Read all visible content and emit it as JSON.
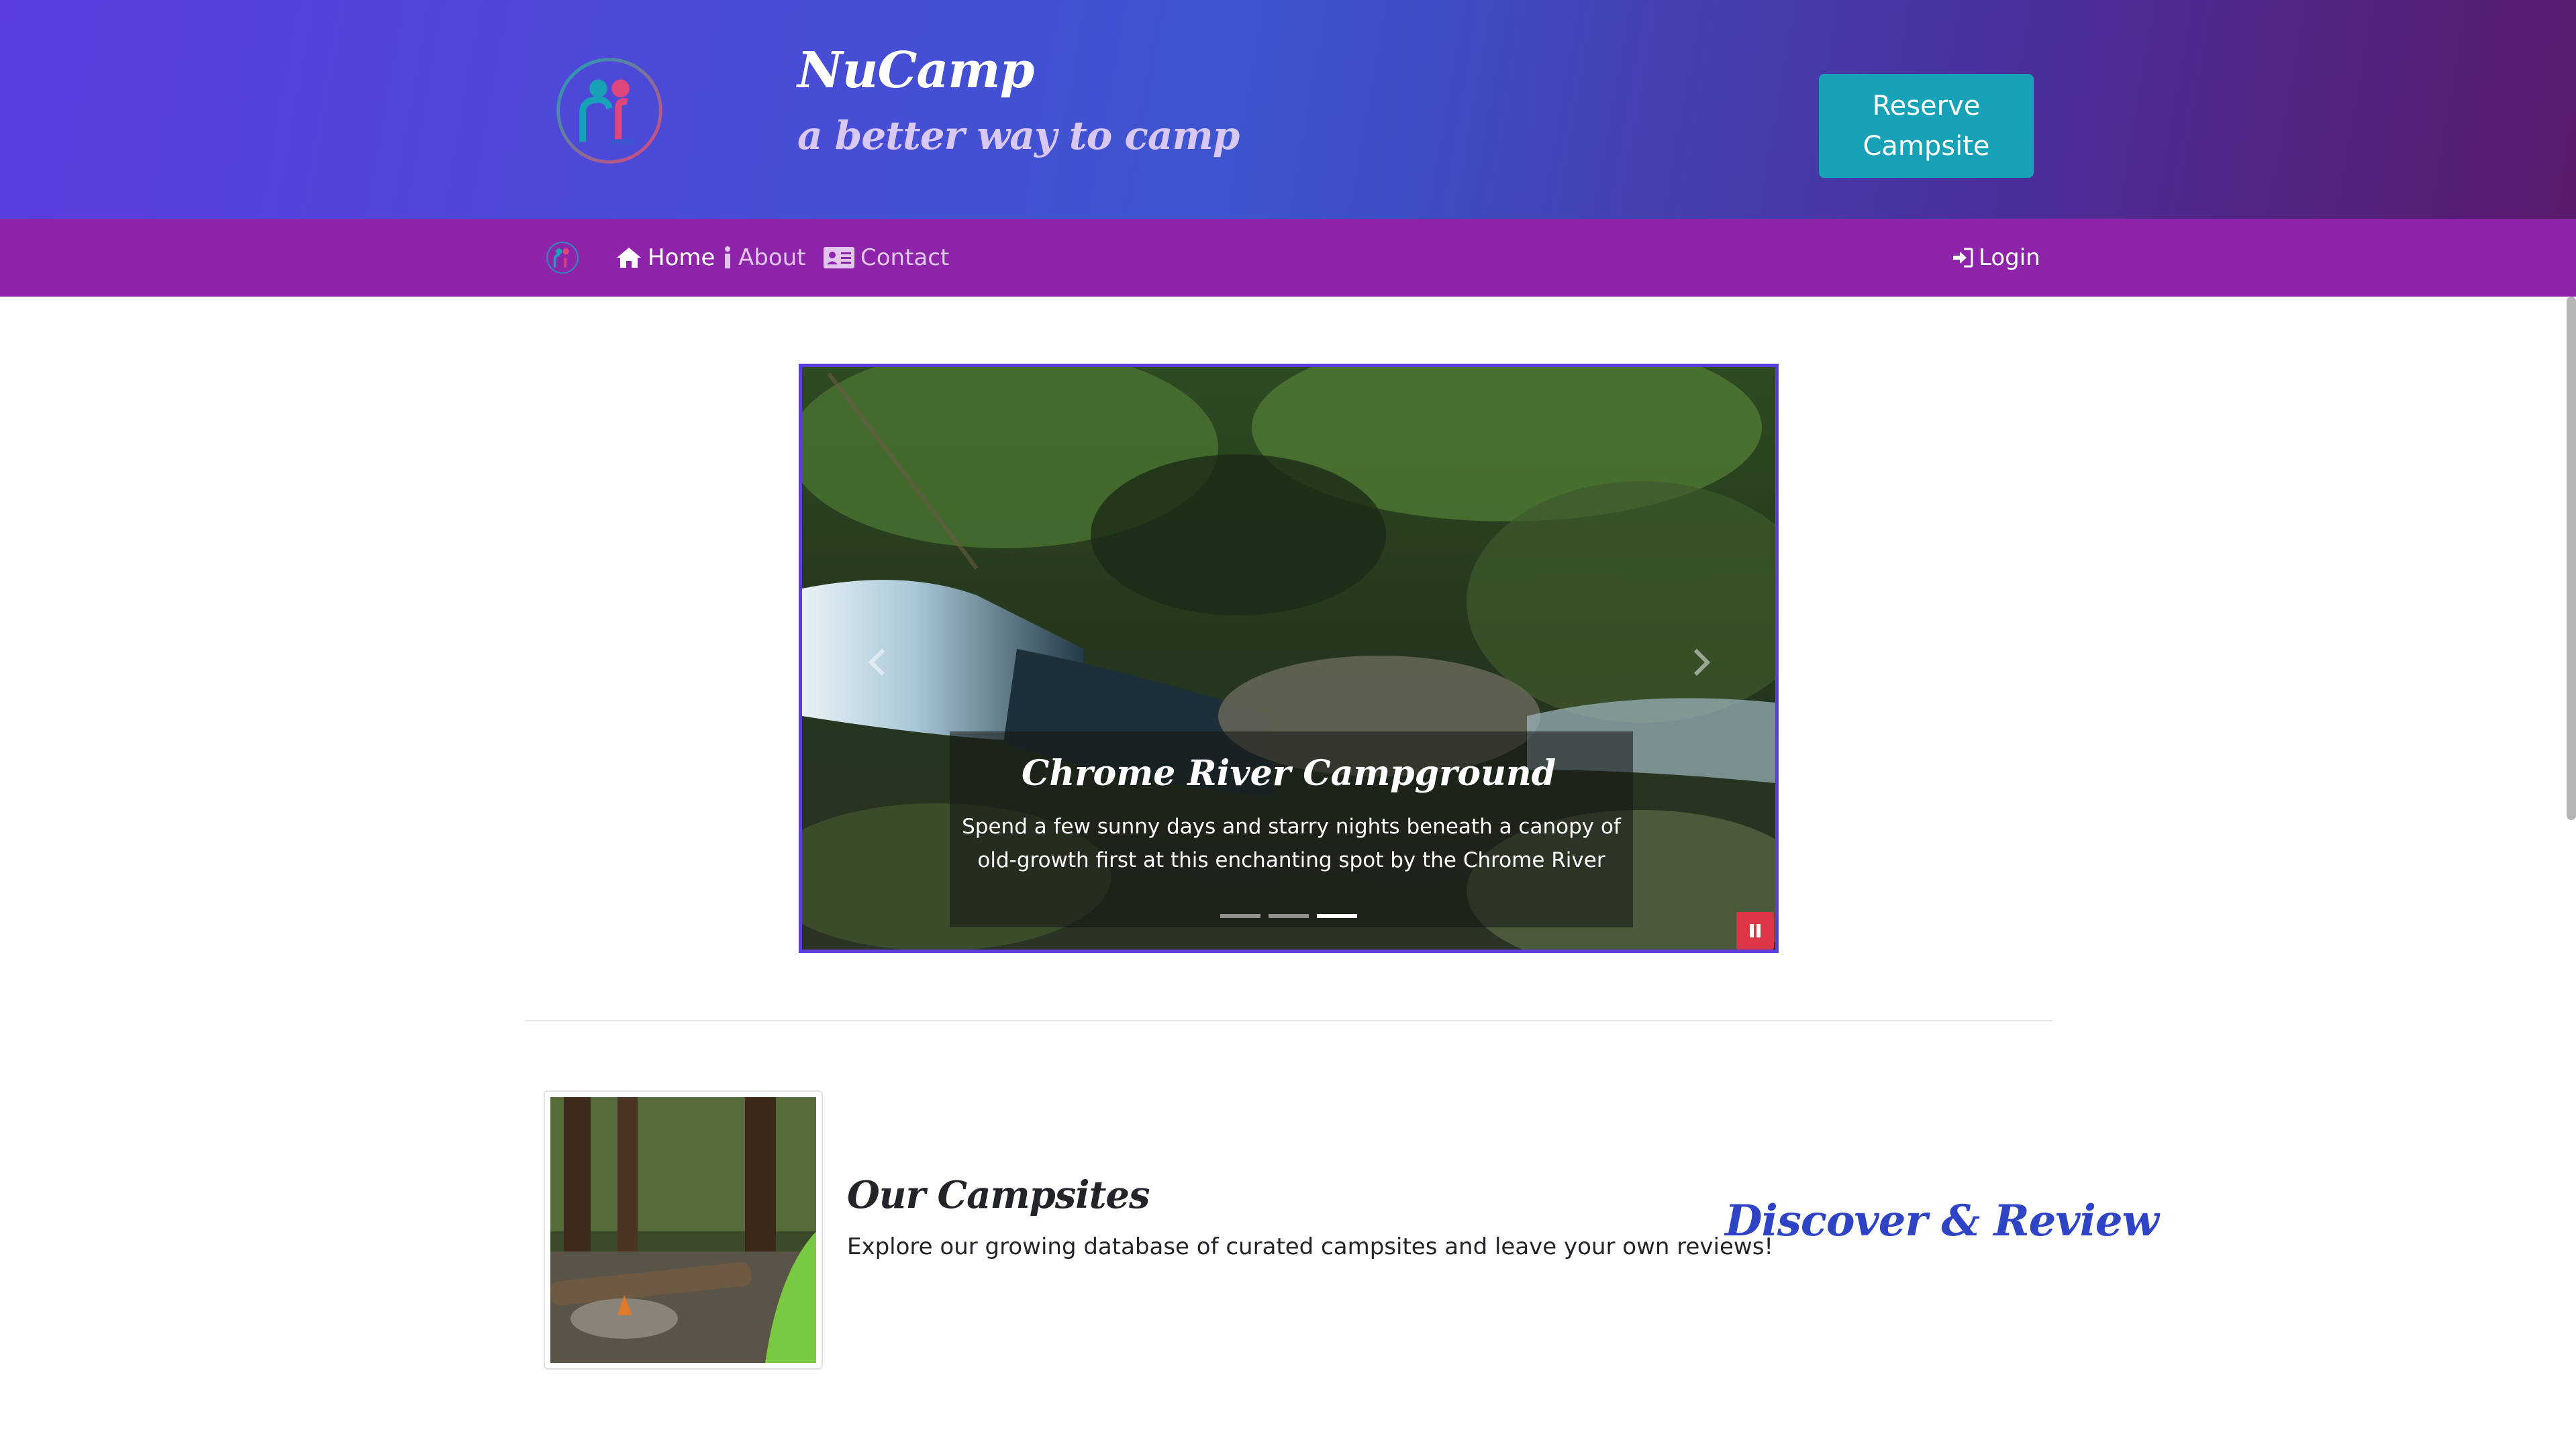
{
  "header": {
    "brand_title": "NuCamp",
    "brand_subtitle": "a better way to camp",
    "reserve_button": "Reserve Campsite"
  },
  "navbar": {
    "items": [
      {
        "label": "Home",
        "icon": "home-icon",
        "active": true
      },
      {
        "label": "About",
        "icon": "info-icon",
        "active": false
      },
      {
        "label": "Contact",
        "icon": "address-card-icon",
        "active": false
      }
    ],
    "login": {
      "label": "Login",
      "icon": "sign-in-icon"
    }
  },
  "carousel": {
    "caption_title": "Chrome River Campground",
    "caption_text": "Spend a few sunny days and starry nights beneath a canopy of old-growth first at this enchanting spot by the Chrome River",
    "slide_count": 3,
    "active_slide": 3
  },
  "campsites": {
    "title": "Our Campsites",
    "description": "Explore our growing database of curated campsites and leave your own reviews!",
    "link_label": "Discover & Review"
  },
  "colors": {
    "header_gradient_start": "#5b3de0",
    "header_gradient_end": "#5a1a6b",
    "navbar": "#8e24aa",
    "reserve_button": "#17a2b8",
    "carousel_border": "#5b3de0",
    "pause_button": "#dc3545",
    "link": "#2f44c4"
  }
}
